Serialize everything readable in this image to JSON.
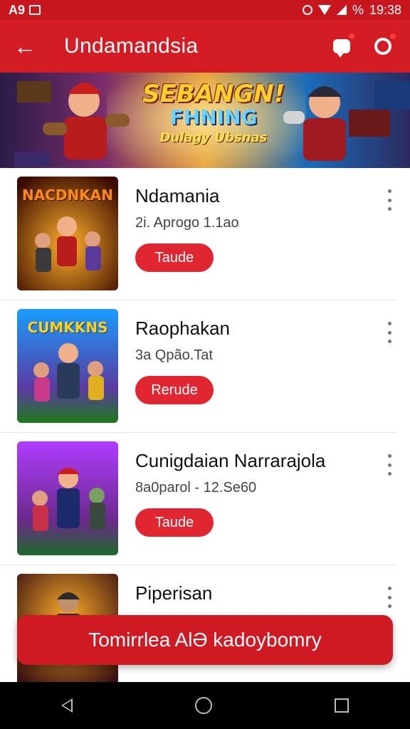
{
  "status_bar": {
    "left_text": "A9",
    "time": "19:38",
    "battery": "%"
  },
  "app_bar": {
    "back_icon": "arrow-left-icon",
    "title": "Undamandsia",
    "chat_icon": "chat-bubble-icon",
    "profile_icon": "profile-icon"
  },
  "banner": {
    "line1": "SEBANGN!",
    "line2": "FHNING",
    "line3": "Dulagy Ubsnas"
  },
  "items": [
    {
      "title": "Ndamania",
      "subtitle": "2i. Aprogo 1.1ao",
      "button": "Taude",
      "thumb_title": "NACDNKAN",
      "colors": [
        "#ff6a00",
        "#3a0a00"
      ]
    },
    {
      "title": "Raophakan",
      "subtitle": "3a Qpão.Tat",
      "button": "Rerude",
      "thumb_title": "CUMKKNS",
      "colors": [
        "#1a9cff",
        "#1e7a1a"
      ]
    },
    {
      "title": "Cunigdaian Narrarajola",
      "subtitle": "8a0parol - 12.Se60",
      "button": "Taude",
      "thumb_title": "",
      "colors": [
        "#b03cff",
        "#1e6a2a"
      ]
    },
    {
      "title": "Piperisan",
      "subtitle": "",
      "button": "",
      "thumb_title": "",
      "colors": [
        "#ff8a00",
        "#1a1010"
      ]
    }
  ],
  "snackbar": {
    "text": "Tomirrlea AlƏ kadoybomry"
  },
  "nav_bar": {
    "back": "triangle-back-icon",
    "home": "circle-home-icon",
    "recents": "square-recents-icon"
  }
}
